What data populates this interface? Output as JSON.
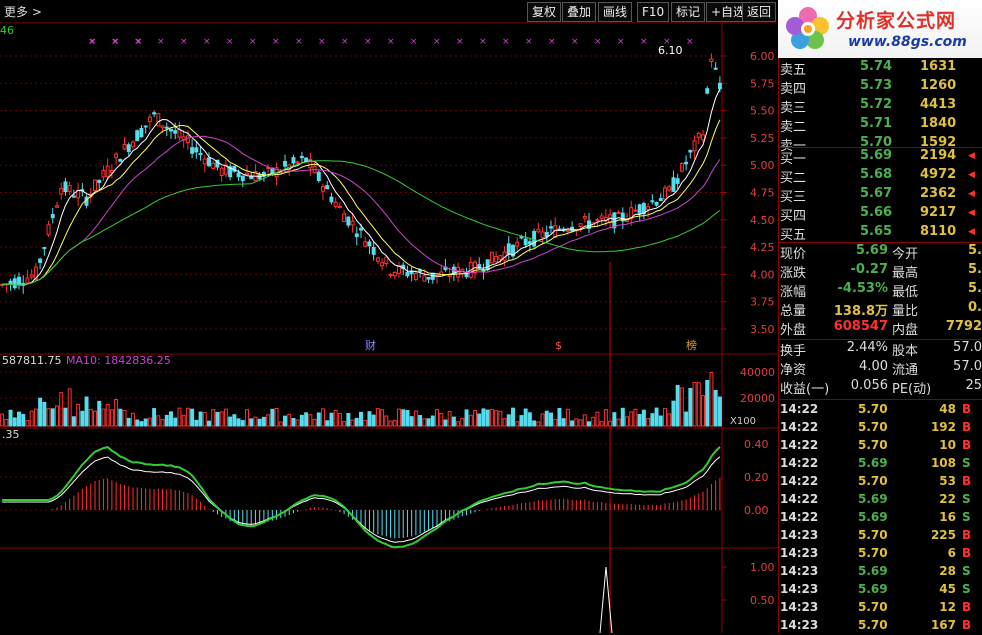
{
  "toolbar": {
    "more": "更多 >",
    "buttons": [
      "复权",
      "叠加",
      "画线",
      "F10",
      "标记",
      "+自选",
      "返回"
    ]
  },
  "logo": {
    "title": "分析家公式网",
    "url": "www.88gs.com"
  },
  "chart": {
    "price_axis": [
      "6.00",
      "5.75",
      "5.50",
      "5.25",
      "5.00",
      "4.75",
      "4.50",
      "4.25",
      "4.00",
      "3.75",
      "3.50"
    ],
    "volume_axis": [
      "40000",
      "20000"
    ],
    "volume_unit": "X100",
    "macd_axis": [
      "0.40",
      "0.20",
      "0.00"
    ],
    "bottom_axis": [
      "1.00",
      "0.50"
    ],
    "high_label": "6.10",
    "corner_label": "46",
    "vol_label": "587811.75",
    "ma10_label": "MA10: 1842836.25",
    "macd_label": ".35",
    "markers": [
      "财",
      "$",
      "榜"
    ]
  },
  "orderbook": {
    "sell": [
      {
        "label": "卖五",
        "price": "5.74",
        "vol": "1631"
      },
      {
        "label": "卖四",
        "price": "5.73",
        "vol": "1260"
      },
      {
        "label": "卖三",
        "price": "5.72",
        "vol": "4413"
      },
      {
        "label": "卖二",
        "price": "5.71",
        "vol": "1840"
      },
      {
        "label": "卖一",
        "price": "5.70",
        "vol": "1592"
      }
    ],
    "buy": [
      {
        "label": "买一",
        "price": "5.69",
        "vol": "2194"
      },
      {
        "label": "买二",
        "price": "5.68",
        "vol": "4972"
      },
      {
        "label": "买三",
        "price": "5.67",
        "vol": "2362"
      },
      {
        "label": "买四",
        "price": "5.66",
        "vol": "9217"
      },
      {
        "label": "买五",
        "price": "5.65",
        "vol": "8110"
      }
    ]
  },
  "stats": [
    {
      "l1": "现价",
      "v1": "5.69",
      "c1": "#4caf50",
      "l2": "今开",
      "v2": "5."
    },
    {
      "l1": "涨跌",
      "v1": "-0.27",
      "c1": "#4caf50",
      "l2": "最高",
      "v2": "5."
    },
    {
      "l1": "涨幅",
      "v1": "-4.53%",
      "c1": "#4caf50",
      "l2": "最低",
      "v2": "5."
    },
    {
      "l1": "总量",
      "v1": "138.8万",
      "c1": "#e0c040",
      "l2": "量比",
      "v2": "0."
    },
    {
      "l1": "外盘",
      "v1": "608547",
      "c1": "#ff3030",
      "l2": "内盘",
      "v2": "7792"
    }
  ],
  "stats2": [
    {
      "l1": "换手",
      "v1": "2.44%",
      "l2": "股本",
      "v2": "57.0"
    },
    {
      "l1": "净资",
      "v1": "4.00",
      "l2": "流通",
      "v2": "57.0"
    },
    {
      "l1": "收益(一)",
      "v1": "0.056",
      "l2": "PE(动)",
      "v2": "25"
    }
  ],
  "trades": [
    {
      "t": "14:22",
      "p": "5.70",
      "v": "48",
      "s": "B"
    },
    {
      "t": "14:22",
      "p": "5.70",
      "v": "192",
      "s": "B"
    },
    {
      "t": "14:22",
      "p": "5.70",
      "v": "10",
      "s": "B"
    },
    {
      "t": "14:22",
      "p": "5.69",
      "v": "108",
      "s": "S"
    },
    {
      "t": "14:22",
      "p": "5.70",
      "v": "53",
      "s": "B"
    },
    {
      "t": "14:22",
      "p": "5.69",
      "v": "22",
      "s": "S"
    },
    {
      "t": "14:22",
      "p": "5.69",
      "v": "16",
      "s": "S"
    },
    {
      "t": "14:23",
      "p": "5.70",
      "v": "225",
      "s": "B"
    },
    {
      "t": "14:23",
      "p": "5.70",
      "v": "6",
      "s": "B"
    },
    {
      "t": "14:23",
      "p": "5.69",
      "v": "28",
      "s": "S"
    },
    {
      "t": "14:23",
      "p": "5.69",
      "v": "45",
      "s": "S"
    },
    {
      "t": "14:23",
      "p": "5.70",
      "v": "12",
      "s": "B"
    },
    {
      "t": "14:23",
      "p": "5.70",
      "v": "167",
      "s": "B"
    }
  ]
}
